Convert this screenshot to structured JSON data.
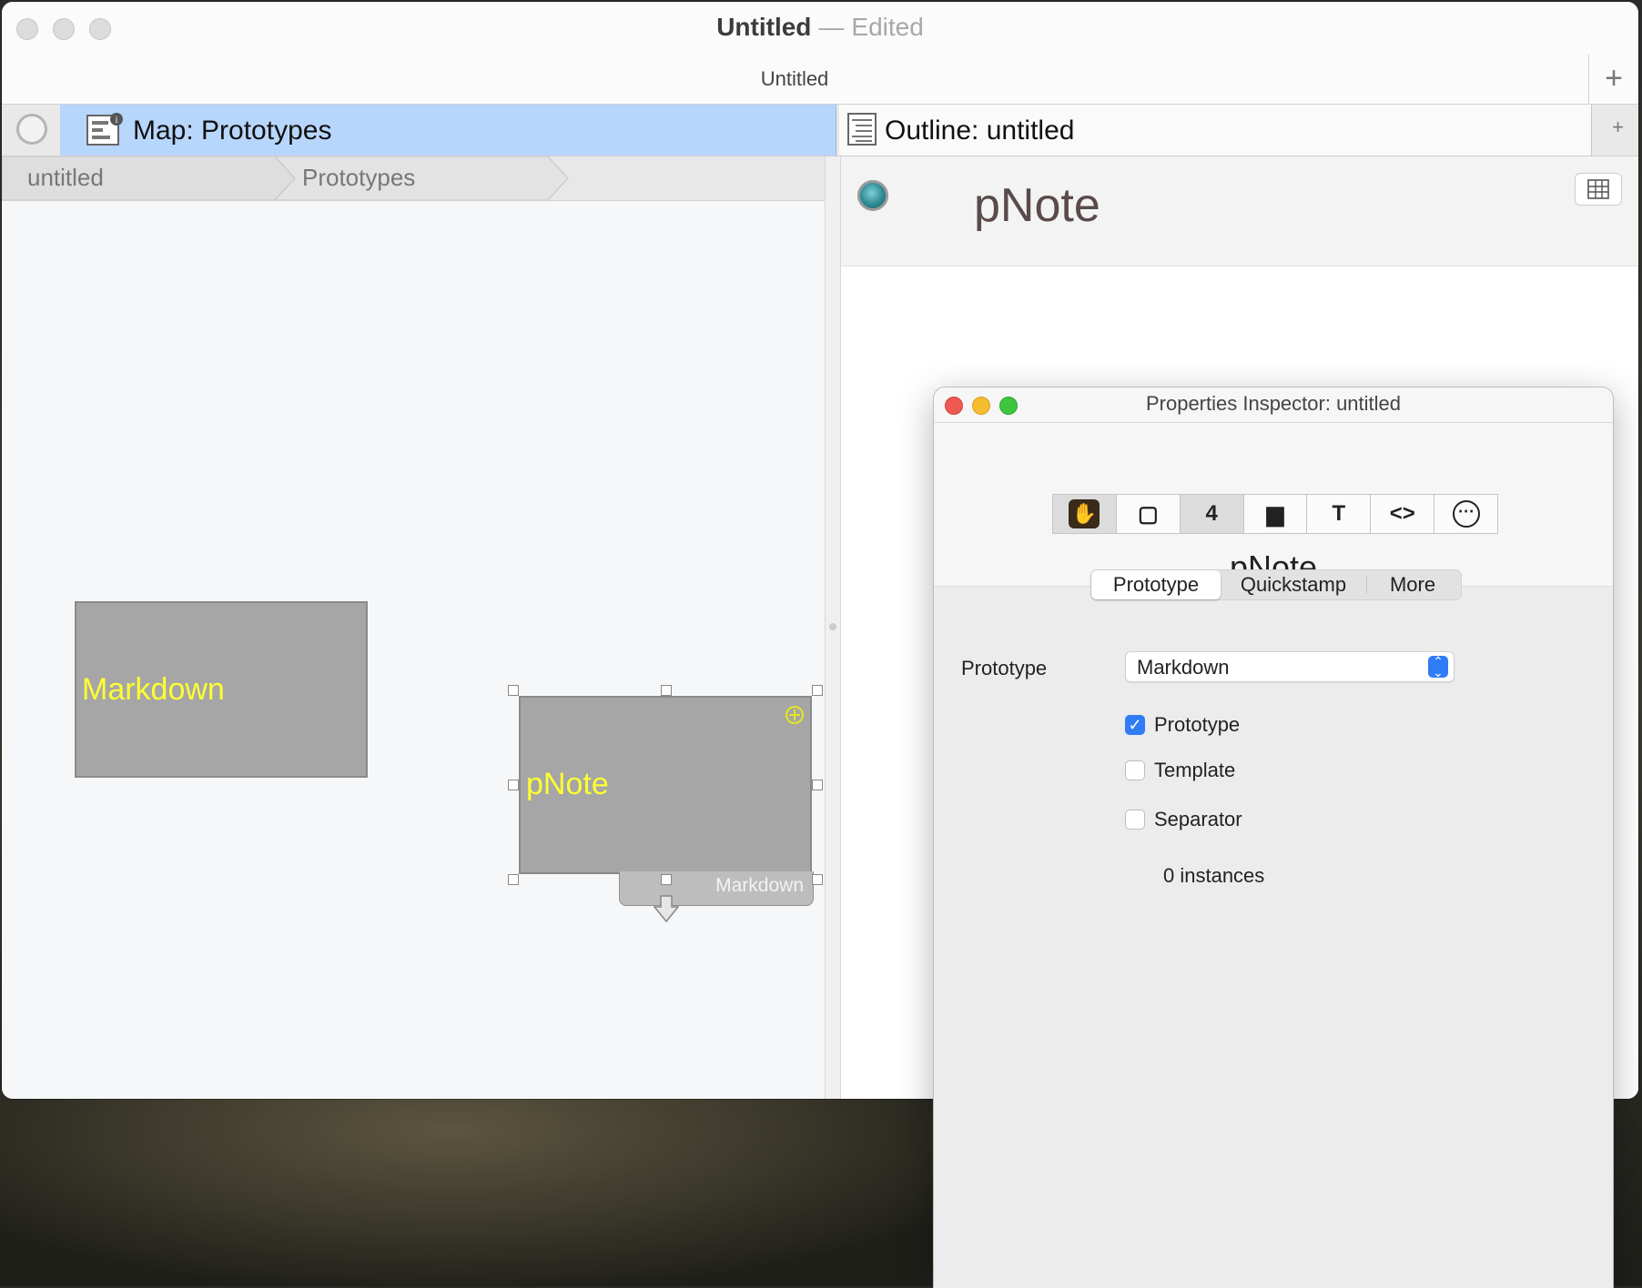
{
  "window": {
    "title": "Untitled",
    "title_sep": "—",
    "status": "Edited",
    "doc_tab": "Untitled",
    "new_tab": "+"
  },
  "tabs": {
    "map_label": "Map: Prototypes",
    "outline_label": "Outline: untitled",
    "add": "+"
  },
  "breadcrumb": [
    "untitled",
    "Prototypes"
  ],
  "map": {
    "notes": [
      {
        "label": "Markdown",
        "color": "#ffff33"
      },
      {
        "label": "pNote",
        "color": "#ffff33"
      }
    ],
    "prototype_tag": "Markdown"
  },
  "outline": {
    "title": "pNote"
  },
  "inspector": {
    "title": "Properties Inspector: untitled",
    "toolbar_icons": [
      "prototype-hand-icon",
      "page-icon",
      "number-badge-icon",
      "window-icon",
      "text-icon",
      "code-icon",
      "more-icon"
    ],
    "toolbar_glyphs": [
      "✋",
      "▢",
      "4",
      "▆",
      "T",
      "<>",
      "⋯"
    ],
    "note_name": "pNote",
    "segments": [
      "Prototype",
      "Quickstamp",
      "More"
    ],
    "selected_segment": "Prototype",
    "prototype_label": "Prototype",
    "prototype_value": "Markdown",
    "checkboxes": [
      {
        "label": "Prototype",
        "checked": true
      },
      {
        "label": "Template",
        "checked": false
      },
      {
        "label": "Separator",
        "checked": false
      }
    ],
    "instances": "0 instances"
  },
  "colors": {
    "accent": "#2f7cf6",
    "map_tab": "#b7d6fb",
    "note_fill": "#a6a6a6"
  }
}
